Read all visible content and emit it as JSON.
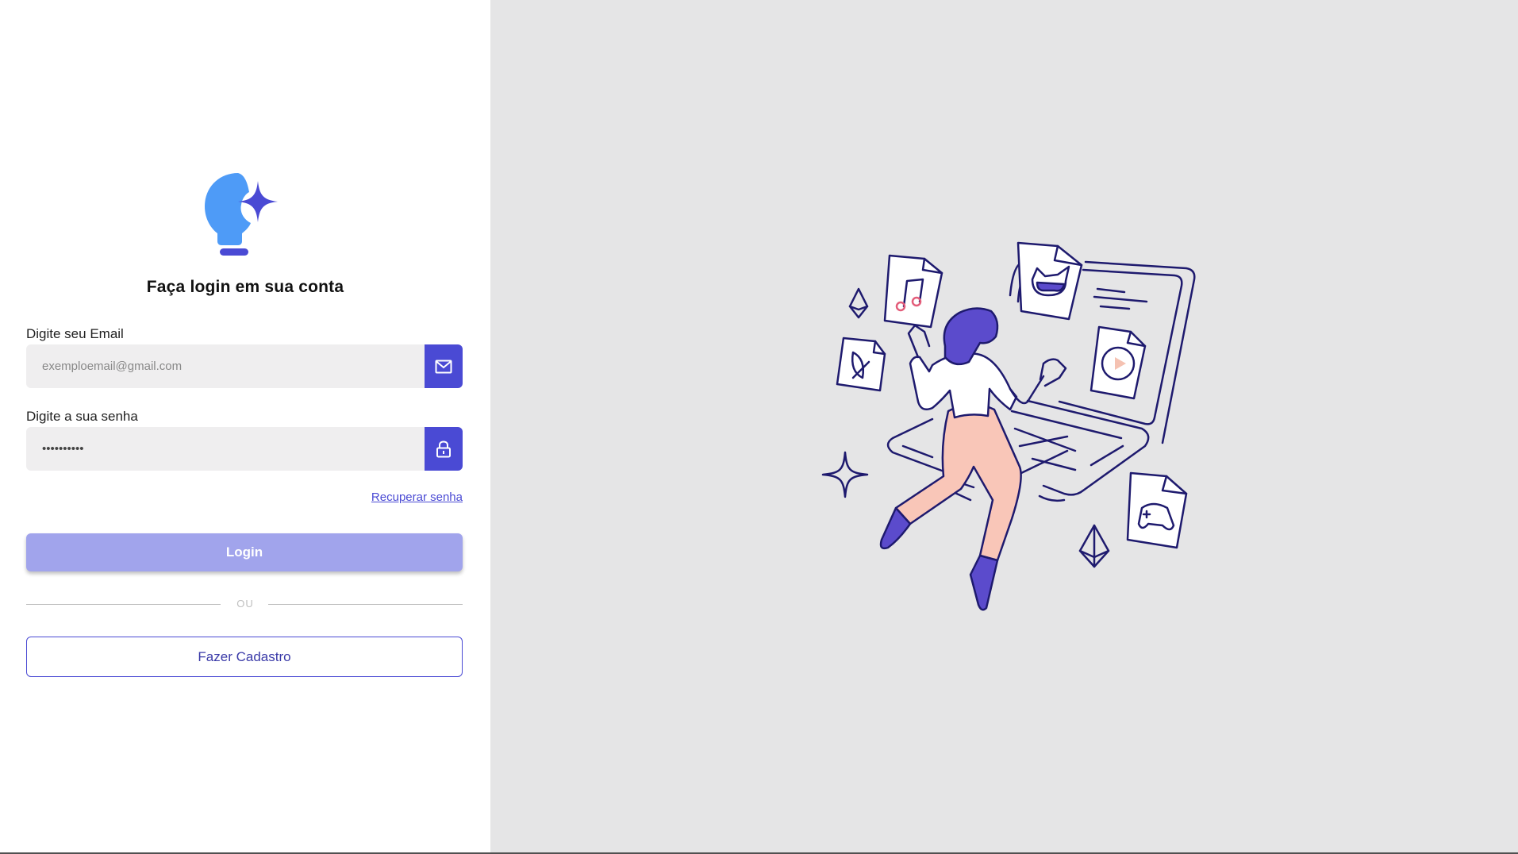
{
  "login": {
    "title": "Faça login em sua conta",
    "email_label": "Digite seu Email",
    "email_placeholder": "exemploemail@gmail.com",
    "password_label": "Digite a sua senha",
    "password_value": "**********",
    "recover_link": "Recuperar senha",
    "login_button": "Login",
    "divider": "OU",
    "signup_button": "Fazer Cadastro"
  },
  "icons": {
    "logo": "lightbulb-sparkle-icon",
    "email": "mail-icon",
    "password": "lock-icon"
  },
  "colors": {
    "primary": "#4a4ad4",
    "button_disabled": "#a1a4ec",
    "logo_blue": "#4e9bf7",
    "input_bg": "#efeeef",
    "right_bg": "#e5e5e6"
  }
}
